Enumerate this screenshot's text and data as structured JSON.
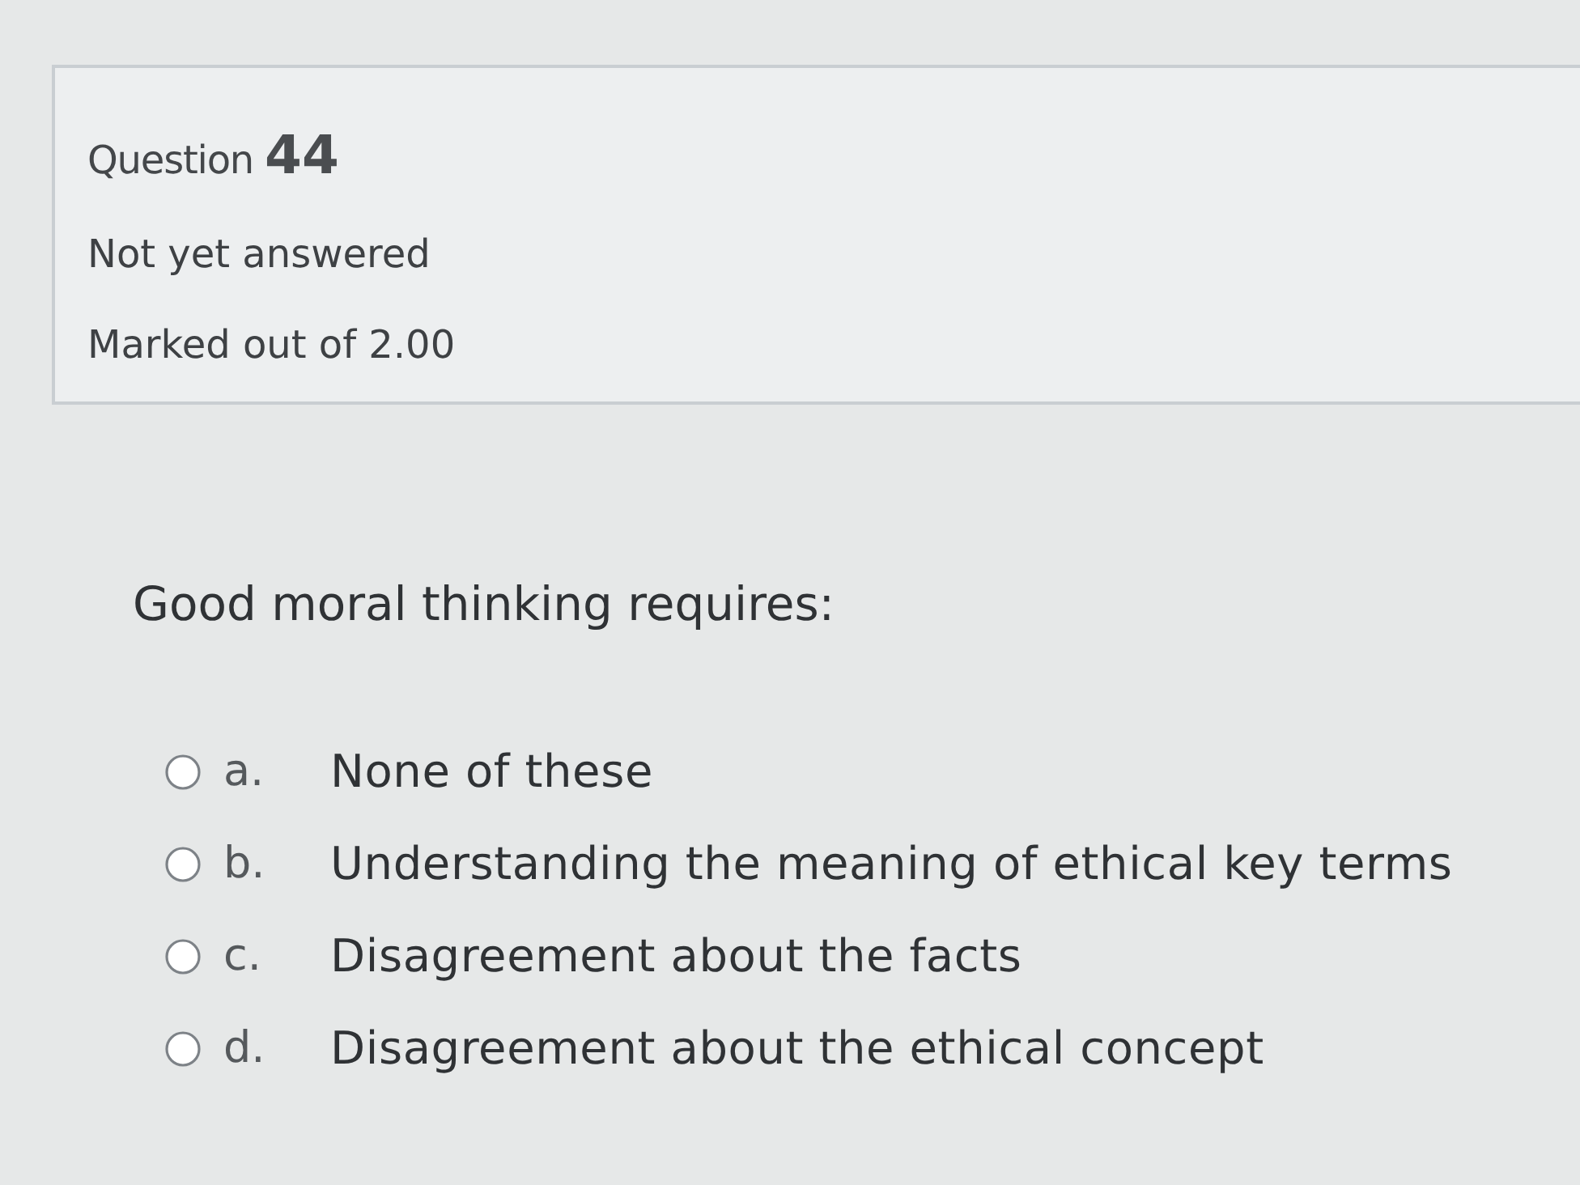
{
  "question_info": {
    "label": "Question",
    "number": "44",
    "state": "Not yet answered",
    "mark": "Marked out of 2.00"
  },
  "question_text": "Good moral thinking requires:",
  "options": [
    {
      "letter": "a.",
      "text": "None of these",
      "selected": false
    },
    {
      "letter": "b.",
      "text": "Understanding the meaning of ethical key terms",
      "selected": false
    },
    {
      "letter": "c.",
      "text": "Disagreement about the facts",
      "selected": false
    },
    {
      "letter": "d.",
      "text": "Disagreement about the ethical concept",
      "selected": false
    }
  ]
}
